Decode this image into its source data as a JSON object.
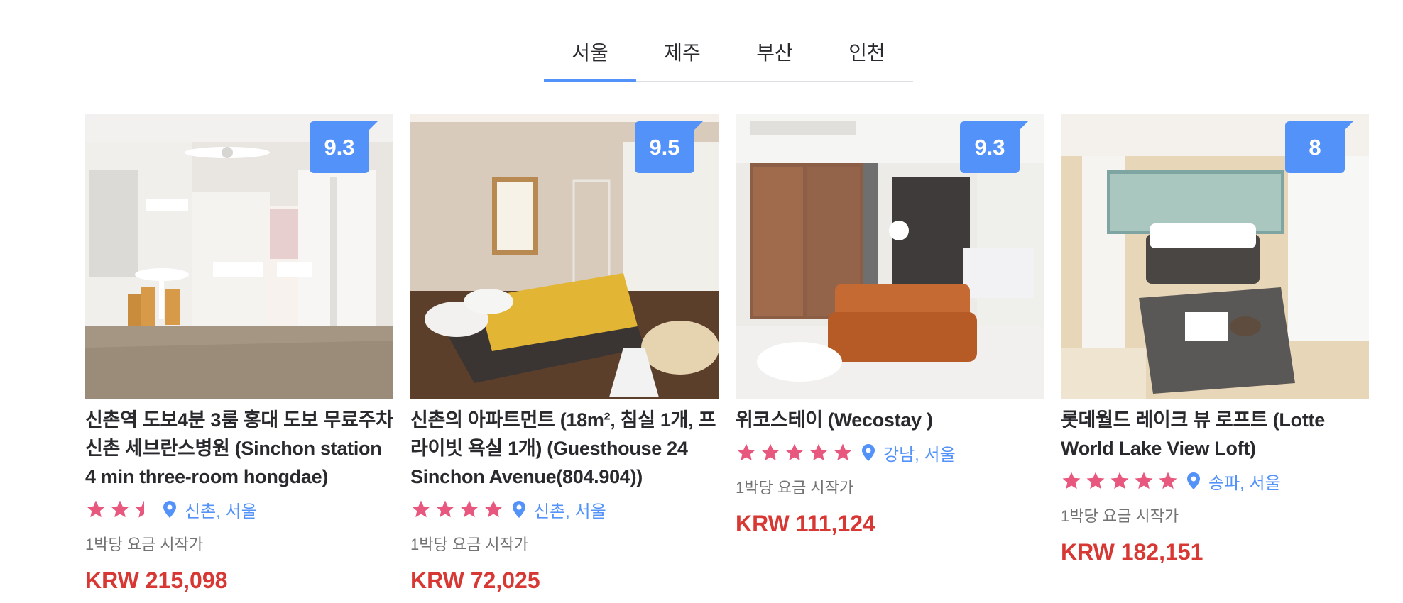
{
  "tabs": [
    {
      "label": "서울",
      "active": true
    },
    {
      "label": "제주",
      "active": false
    },
    {
      "label": "부산",
      "active": false
    },
    {
      "label": "인천",
      "active": false
    }
  ],
  "cards": [
    {
      "score": "9.3",
      "name": "신촌역 도보4분 3룸 홍대 도보 무료주차 신촌 세브란스병원 (Sinchon station 4 min three-room hongdae)",
      "rating_stars": 2.5,
      "location": "신촌, 서울",
      "price_label": "1박당 요금 시작가",
      "price": "KRW 215,098"
    },
    {
      "score": "9.5",
      "name": "신촌의 아파트먼트 (18m², 침실 1개, 프라이빗 욕실 1개) (Guesthouse 24 Sinchon Avenue(804.904))",
      "rating_stars": 4,
      "location": "신촌, 서울",
      "price_label": "1박당 요금 시작가",
      "price": "KRW 72,025"
    },
    {
      "score": "9.3",
      "name": "위코스테이 (Wecostay )",
      "rating_stars": 5,
      "location": "강남, 서울",
      "price_label": "1박당 요금 시작가",
      "price": "KRW 111,124"
    },
    {
      "score": "8",
      "name": "롯데월드 레이크 뷰 로프트 (Lotte World Lake View Loft)",
      "rating_stars": 5,
      "location": "송파, 서울",
      "price_label": "1박당 요금 시작가",
      "price": "KRW 182,151"
    }
  ],
  "colors": {
    "accent": "#5392f9",
    "star": "#e8577e",
    "price": "#d83834"
  },
  "icons": {
    "star": "star-icon",
    "location": "map-pin-icon"
  }
}
